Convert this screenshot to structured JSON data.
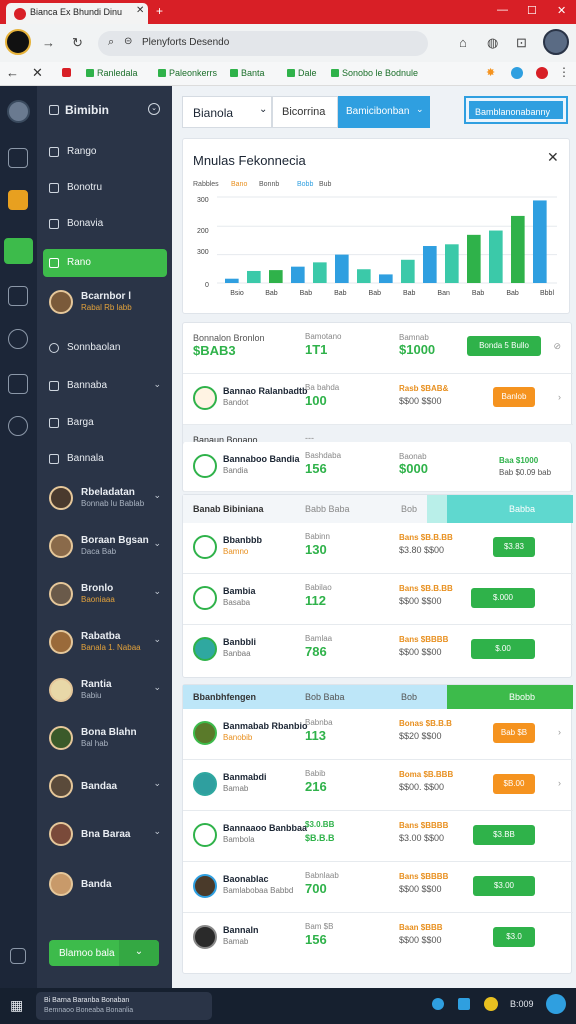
{
  "browser": {
    "tab_title": "Bianca Ex Bhundi Dinu",
    "url": "Plenyforts Desendo",
    "bookmarks": [
      "Ranledala",
      "Paleonkerrs",
      "Banta",
      "Dale",
      "Sonobo le Bodnule"
    ]
  },
  "sidebar": {
    "header": "Bimibin",
    "items": [
      {
        "label": "Rango"
      },
      {
        "label": "Bonotru"
      },
      {
        "label": "Bonavia"
      },
      {
        "label": "Rano",
        "active": true
      },
      {
        "label": "Bcarnbor l",
        "sub": "Rabal Rb labb",
        "person": true
      },
      {
        "label": "Sonnbaolan"
      },
      {
        "label": "Bannaba",
        "chevron": true
      },
      {
        "label": "Barga"
      },
      {
        "label": "Bannala"
      },
      {
        "label": "Rbeladatan",
        "sub": "Bonnab lu Bablab",
        "person": true,
        "chevron": true
      },
      {
        "label": "Boraan Bgsan",
        "sub": "Daca Bab",
        "person": true,
        "chevron": true
      },
      {
        "label": "Bronlo",
        "sub": "Baoniaaa",
        "person": true,
        "chevron": true
      },
      {
        "label": "Rabatba",
        "sub": "Banala 1. Nabaa",
        "person": true,
        "chevron": true
      },
      {
        "label": "Rantia",
        "sub": "Babiu",
        "person": true,
        "chevron": true
      },
      {
        "label": "Bona Blahn",
        "sub": "Bal hab",
        "person": true
      },
      {
        "label": "Bandaa",
        "person": true,
        "chevron": true
      },
      {
        "label": "Bna Baraa",
        "person": true,
        "chevron": true
      },
      {
        "label": "Banda",
        "person": true
      }
    ],
    "cta": "Blamoo bala"
  },
  "topnav": {
    "select": "Bianola",
    "tab2": "Bicorrina",
    "tab3": "Bamicibonban",
    "action": "Bamblanonabanny"
  },
  "chart_card": {
    "title": "Mnulas Fekonnecia",
    "legend": [
      "Rabbles",
      "Bano",
      "Bonnb",
      "Bobb",
      "Bub"
    ],
    "yticks": [
      "300",
      "200",
      "300",
      "0"
    ],
    "xticks": [
      "Bsio",
      "Bab",
      "Bab",
      "Bab",
      "Bab",
      "Bab",
      "Ban",
      "Bab",
      "Bab",
      "Bbbl"
    ]
  },
  "chart_data": {
    "type": "bar",
    "title": "Mnulas Fekonnecia",
    "series": [
      {
        "name": "Bano",
        "values": [
          5,
          14,
          15,
          19,
          24,
          33,
          16,
          10,
          27,
          43,
          45,
          56,
          61,
          78,
          96
        ]
      }
    ],
    "colors": [
      "#2f9fe0",
      "#3bc9a9",
      "#2fb24a",
      "#2f9fe0",
      "#3bc9a9",
      "#2f9fe0",
      "#3bc9a9",
      "#2f9fe0",
      "#3bc9a9",
      "#2f9fe0",
      "#3bc9a9",
      "#2fb24a",
      "#3bc9a9",
      "#2fb24a",
      "#2f9fe0"
    ],
    "ylim": [
      0,
      100
    ],
    "grid": true
  },
  "list1": {
    "header": {
      "name": "Bonnalon Bronlon",
      "sub": "$BAB3",
      "mid": "Bamotano",
      "midval": "1T1",
      "cost": "Bamnab",
      "costv": "$1000",
      "btn": "Bonda 5 Bullo"
    },
    "rows": [
      {
        "name": "Bannao Ralanbadtb",
        "sub": "Bandot",
        "mid": "Ba bahda",
        "midval": "100",
        "cost": "Rasb $BAB&",
        "costv": "$$00 $$00",
        "btn": "Banlob",
        "btncolor": "orange"
      }
    ]
  },
  "section1": {
    "title": "Banaun Bonano",
    "right": "---"
  },
  "list2": {
    "rows": [
      {
        "name": "Bannaboo Bandia",
        "sub": "Bandia",
        "mid": "Bashdaba",
        "midval": "156",
        "cost": "Baonab",
        "costv": "$000",
        "btn": "Baa $1000",
        "btncolor": "none",
        "btnsub": "Bab $0.09 bab"
      }
    ]
  },
  "section2": {
    "title": "Banab Bibiniana",
    "mid": "Babb Baba",
    "right1": "Bob",
    "right2": "Babba"
  },
  "list3": {
    "rows": [
      {
        "name": "Bbanbbb",
        "sub": "Bamno",
        "mid": "Babinn",
        "midval": "130",
        "cost": "Bans $B.B.BB",
        "costv": "$3.80 $$00",
        "btn": "$3.83",
        "btncolor": "green"
      },
      {
        "name": "Bambia",
        "sub": "Basaba",
        "mid": "Babilao",
        "midval": "112",
        "cost": "Bans $B.B.BB",
        "costv": "$$00 $$00",
        "btn": "$.000",
        "btncolor": "green"
      },
      {
        "name": "Banbbli",
        "sub": "Banbaa",
        "mid": "Bamlaa",
        "midval": "786",
        "cost": "Bans $BBBB",
        "costv": "$$00 $$00",
        "btn": "$.00",
        "btncolor": "green"
      }
    ]
  },
  "section3": {
    "title": "Bbanbhfengen",
    "mid": "Bob Baba",
    "right1": "Bob",
    "right2": "Bbobb"
  },
  "list4": {
    "rows": [
      {
        "name": "Banmabab Rbanbio",
        "sub": "Banobib",
        "mid": "Babnba",
        "midval": "113",
        "cost": "Bonas $B.B.B",
        "costv": "$$20 $$00",
        "btn": "Bab $B",
        "btncolor": "orange"
      },
      {
        "name": "Banmabdi",
        "sub": "Bamab",
        "mid": "Babib",
        "midval": "216",
        "cost": "Boma $B.BBB",
        "costv": "$$00. $$00",
        "btn": "$B.00",
        "btncolor": "orange"
      },
      {
        "name": "Bannaaoo Banbbaa",
        "sub": "Bambola",
        "mid": "$3.0.BB",
        "midval": "$B.B.B",
        "cost": "Bans $BBBB",
        "costv": "$3.00 $$00",
        "btn": "$3.BB",
        "btncolor": "green"
      },
      {
        "name": "Baonablac",
        "sub": "Bamlabobaa Babbd",
        "mid": "Babnlaab",
        "midval": "700",
        "cost": "Bans $BBBB",
        "costv": "$$00 $$00",
        "btn": "$3.00",
        "btncolor": "green"
      },
      {
        "name": "Bannaln",
        "sub": "Bamab",
        "mid": "Bam $B",
        "midval": "156",
        "cost": "Baan $BBB",
        "costv": "$$00 $$00",
        "btn": "$3.0",
        "btncolor": "green"
      }
    ]
  },
  "taskbar": {
    "search_line1": "Bi Barna Baranba Bonaban",
    "search_line2": "Bemnaoo Boneaba Bonanlia",
    "clock": "B:009"
  },
  "colors": {
    "accent_green": "#2fb24a",
    "accent_blue": "#2f9fe0",
    "accent_orange": "#f5931f",
    "titlebar_red": "#d81f26"
  }
}
